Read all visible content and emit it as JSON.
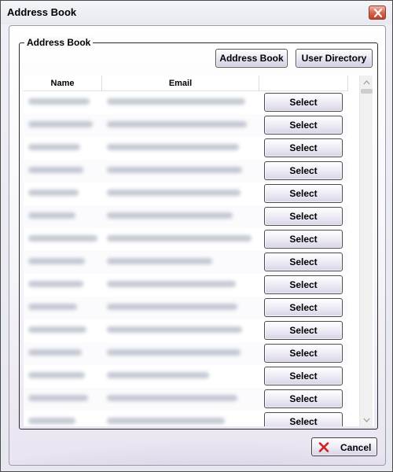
{
  "window": {
    "title": "Address Book",
    "close_icon": "close-x-icon"
  },
  "group": {
    "label": "Address Book"
  },
  "toolbar": {
    "address_book_label": "Address Book",
    "user_directory_label": "User Directory"
  },
  "grid": {
    "columns": [
      "Name",
      "Email",
      ""
    ],
    "select_label": "Select",
    "row_count": 15
  },
  "footer": {
    "cancel_label": "Cancel",
    "cancel_icon": "red-x-icon"
  },
  "colors": {
    "accent_purple": "#6c5491",
    "cancel_icon_red": "#d11f1f",
    "close_button_red": "#c0402a"
  }
}
